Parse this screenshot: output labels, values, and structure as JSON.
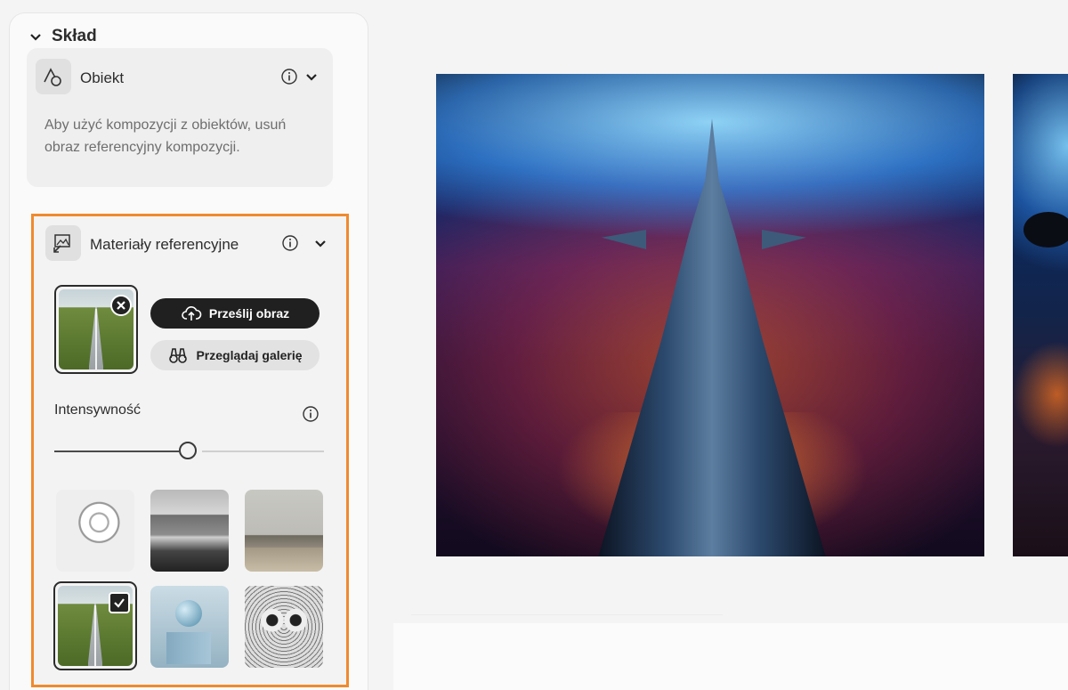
{
  "section": {
    "title": "Skład"
  },
  "object_card": {
    "title": "Obiekt",
    "description": "Aby użyć kompozycji z obiektów, usuń obraz referencyjny kompozycji."
  },
  "reference_card": {
    "title": "Materiały referencyjne",
    "upload_label": "Prześlij obraz",
    "browse_label": "Przeglądaj galerię",
    "intensity_label": "Intensywność",
    "intensity_value": 0.5
  },
  "gallery": {
    "items": [
      "bird-sketch",
      "misty-mountains",
      "living-room",
      "road-field",
      "sphere-on-cube",
      "owl-sketch"
    ],
    "selected": "road-field"
  },
  "colors": {
    "highlight": "#f08a2e",
    "dark_button": "#202020"
  }
}
